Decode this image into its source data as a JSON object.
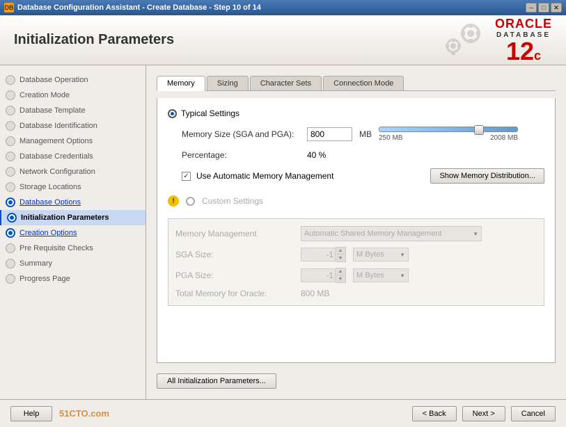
{
  "titleBar": {
    "title": "Database Configuration Assistant - Create Database - Step 10 of 14",
    "minBtn": "─",
    "maxBtn": "□",
    "closeBtn": "✕"
  },
  "header": {
    "title": "Initialization Parameters",
    "oracle": {
      "brand": "ORACLE",
      "product": "DATABASE",
      "version": "12",
      "sup": "c"
    }
  },
  "sidebar": {
    "items": [
      {
        "label": "Database Operation",
        "state": "normal"
      },
      {
        "label": "Creation Mode",
        "state": "normal"
      },
      {
        "label": "Database Template",
        "state": "normal"
      },
      {
        "label": "Database Identification",
        "state": "normal"
      },
      {
        "label": "Management Options",
        "state": "normal"
      },
      {
        "label": "Database Credentials",
        "state": "normal"
      },
      {
        "label": "Network Configuration",
        "state": "normal"
      },
      {
        "label": "Storage Locations",
        "state": "normal"
      },
      {
        "label": "Database Options",
        "state": "link"
      },
      {
        "label": "Initialization Parameters",
        "state": "current"
      },
      {
        "label": "Creation Options",
        "state": "link"
      },
      {
        "label": "Pre Requisite Checks",
        "state": "normal"
      },
      {
        "label": "Summary",
        "state": "normal"
      },
      {
        "label": "Progress Page",
        "state": "normal"
      }
    ]
  },
  "tabs": {
    "items": [
      {
        "label": "Memory",
        "active": true
      },
      {
        "label": "Sizing",
        "active": false
      },
      {
        "label": "Character Sets",
        "active": false
      },
      {
        "label": "Connection Mode",
        "active": false
      }
    ]
  },
  "memory": {
    "typicalSettings": {
      "label": "Typical Settings",
      "memorySize": {
        "label": "Memory Size (SGA and PGA):",
        "value": "800",
        "unit": "MB"
      },
      "slider": {
        "min": "250 MB",
        "max": "2008 MB"
      },
      "percentage": {
        "label": "Percentage:",
        "value": "40 %"
      },
      "checkbox": {
        "label": "Use Automatic Memory Management",
        "checked": true
      },
      "showMemoryBtn": "Show Memory Distribution..."
    },
    "customSettings": {
      "label": "Custom Settings",
      "memoryManagement": {
        "label": "Memory Management",
        "value": "Automatic Shared Memory Management"
      },
      "sgaSize": {
        "label": "SGA Size:",
        "value": "-1",
        "unit": "M Bytes"
      },
      "pgaSize": {
        "label": "PGA Size:",
        "value": "-1",
        "unit": "M Bytes"
      },
      "totalMemory": {
        "label": "Total Memory for Oracle:",
        "value": "800 MB"
      }
    }
  },
  "buttons": {
    "allInitParams": "All Initialization Parameters...",
    "help": "Help",
    "back": "< Back",
    "next": "Next >",
    "cancel": "Cancel"
  },
  "watermark": "51CTO.com"
}
